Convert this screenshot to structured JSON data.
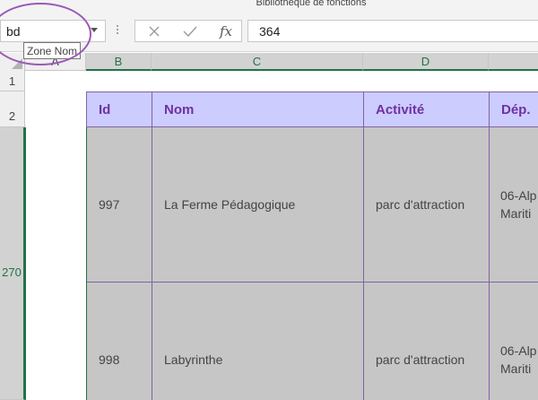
{
  "ribbon": {
    "group_label": "Bibliothèque de fonctions"
  },
  "name_box": {
    "value": "bd",
    "tooltip": "Zone Nom"
  },
  "formula_bar": {
    "insert_function_label": "fx",
    "value": "364"
  },
  "column_headers": [
    "A",
    "B",
    "C",
    "D"
  ],
  "row_headers": [
    "1",
    "2",
    "270"
  ],
  "table": {
    "headers": {
      "id": "Id",
      "nom": "Nom",
      "activite": "Activité",
      "dep": "Dép."
    },
    "rows": [
      {
        "id": "997",
        "nom": "La Ferme Pédagogique",
        "activite": "parc d'attraction",
        "dep": "06-Alp\nMariti"
      },
      {
        "id": "998",
        "nom": "Labyrinthe",
        "activite": "parc d'attraction",
        "dep": "06-Alp\nMariti"
      }
    ]
  },
  "colors": {
    "header_fill": "#ccccff",
    "header_text": "#7030a0",
    "selection_accent": "#217346",
    "highlight_circle": "#9b59b6"
  }
}
